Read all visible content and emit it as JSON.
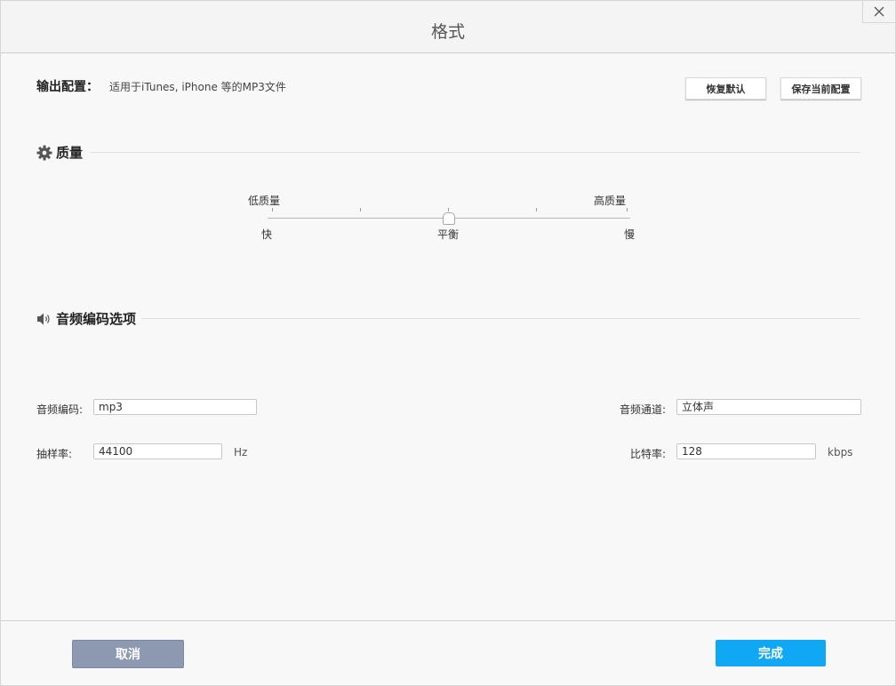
{
  "window": {
    "title": "格式"
  },
  "output": {
    "label": "输出配置：",
    "value": "适用于iTunes, iPhone 等的MP3文件",
    "restore_default": "恢复默认",
    "save_current": "保存当前配置"
  },
  "quality": {
    "title": "质量",
    "low_label": "低质量",
    "high_label": "高质量",
    "fast_label": "快",
    "balanced_label": "平衡",
    "slow_label": "慢",
    "slider_position": 0.5
  },
  "audio": {
    "title": "音频编码选项",
    "codec_label": "音频编码:",
    "codec_value": "mp3",
    "channel_label": "音频通道:",
    "channel_value": "立体声",
    "samplerate_label": "抽样率:",
    "samplerate_value": "44100",
    "samplerate_unit": "Hz",
    "bitrate_label": "比特率:",
    "bitrate_value": "128",
    "bitrate_unit": "kbps"
  },
  "footer": {
    "cancel": "取消",
    "done": "完成"
  },
  "colors": {
    "cancel_bg": "#8d98b1",
    "done_bg": "#10a8f5"
  },
  "icons": {
    "close": "close-icon",
    "quality": "gear-icon",
    "audio": "speaker-icon"
  }
}
